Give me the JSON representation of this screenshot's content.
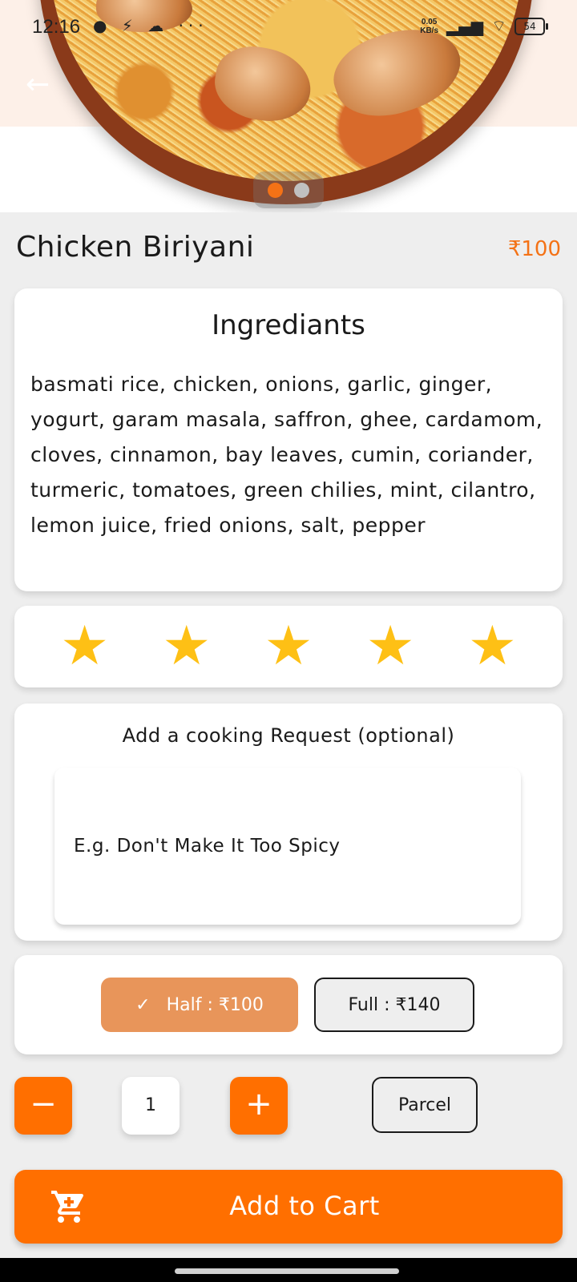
{
  "status_bar": {
    "time": "12:16",
    "left_icons": "● ⚡ ☁ ···",
    "speed_top": "0.05",
    "speed_bottom": "KB/s",
    "signal": "▂▄▆",
    "wifi": "⌔",
    "battery": "54"
  },
  "header": {
    "back_icon": "←",
    "image_description_icon": "food-image",
    "carousel_dots": 2,
    "carousel_active": 0
  },
  "item": {
    "name": "Chicken Biriyani",
    "price": "₹100"
  },
  "ingredients": {
    "title": "Ingrediants",
    "text": "basmati rice, chicken, onions, garlic, ginger, yogurt, garam masala, saffron, ghee, cardamom, cloves, cinnamon, bay leaves, cumin, coriander, turmeric, tomatoes, green chilies, mint, cilantro, lemon juice, fried onions, salt, pepper"
  },
  "rating": {
    "stars": 5,
    "max": 5,
    "star_glyph": "★"
  },
  "cooking_request": {
    "title": "Add a cooking Request (optional)",
    "placeholder": "E.g. Don't Make It Too Spicy",
    "value": ""
  },
  "portions": {
    "check_icon": "✓",
    "half_label": "Half  : ₹100",
    "full_label": "Full  : ₹140",
    "selected": "half"
  },
  "quantity": {
    "minus": "−",
    "plus": "+",
    "value": "1"
  },
  "parcel_label": "Parcel",
  "cart": {
    "label": "Add to Cart",
    "icon": "cart-icon"
  },
  "colors": {
    "accent": "#ff6f00",
    "price": "#f47216",
    "half_selected": "#e8955a",
    "star": "#fec015",
    "background": "#eeeeee"
  }
}
